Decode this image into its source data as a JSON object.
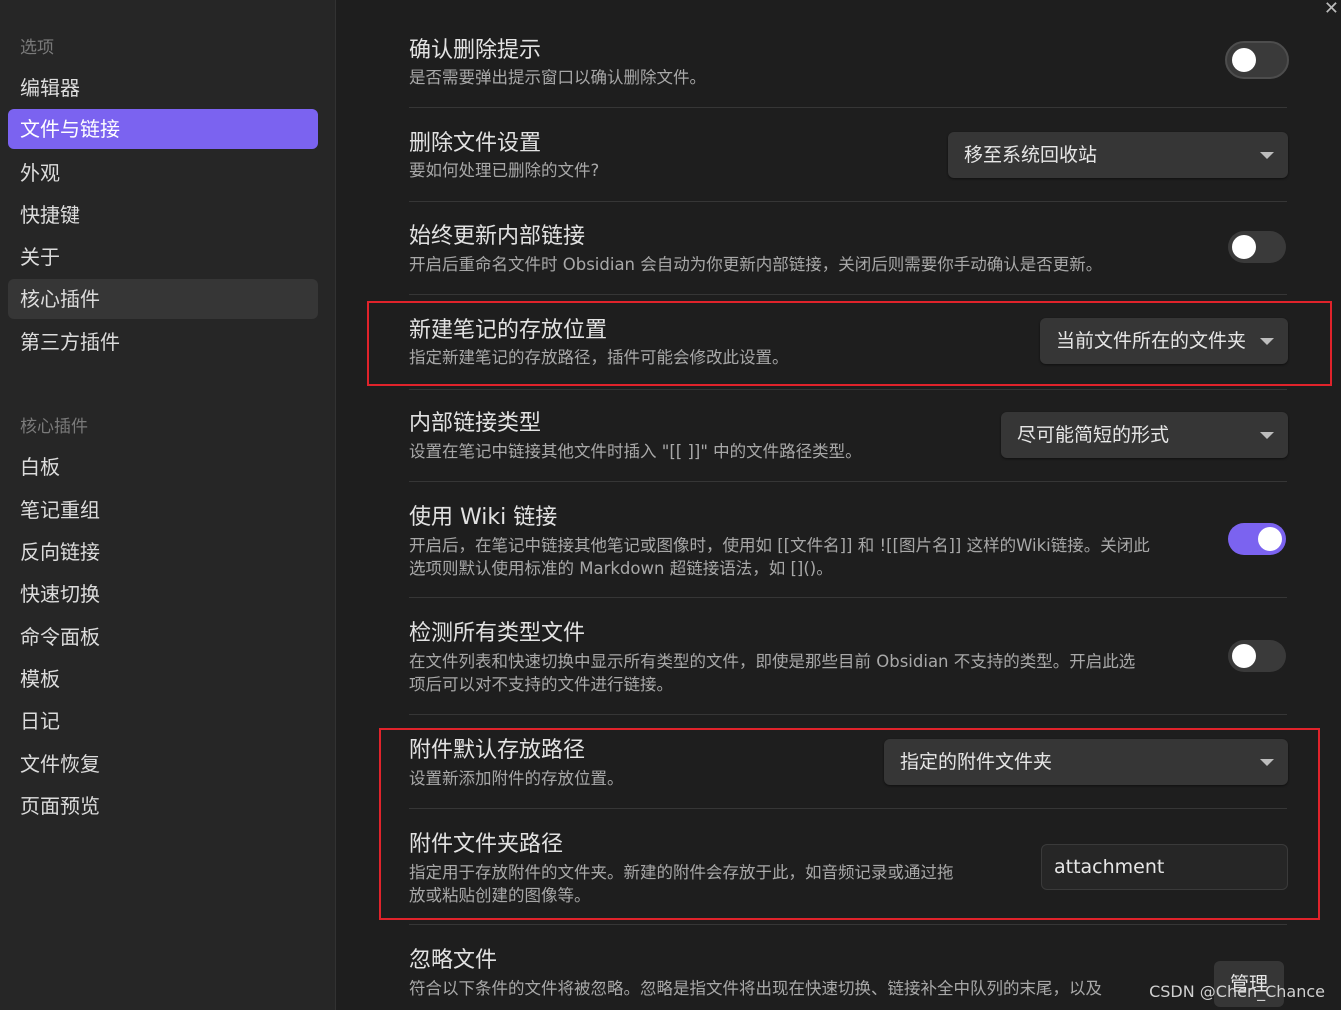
{
  "sidebar": {
    "section_options": "选项",
    "options": [
      {
        "label": "编辑器"
      },
      {
        "label": "文件与链接"
      },
      {
        "label": "外观"
      },
      {
        "label": "快捷键"
      },
      {
        "label": "关于"
      },
      {
        "label": "核心插件"
      },
      {
        "label": "第三方插件"
      }
    ],
    "section_plugins": "核心插件",
    "plugins": [
      {
        "label": "白板"
      },
      {
        "label": "笔记重组"
      },
      {
        "label": "反向链接"
      },
      {
        "label": "快速切换"
      },
      {
        "label": "命令面板"
      },
      {
        "label": "模板"
      },
      {
        "label": "日记"
      },
      {
        "label": "文件恢复"
      },
      {
        "label": "页面预览"
      }
    ]
  },
  "settings": {
    "confirm_delete": {
      "name": "确认删除提示",
      "desc": "是否需要弹出提示窗口以确认删除文件。",
      "enabled": false
    },
    "delete_files": {
      "name": "删除文件设置",
      "desc": "要如何处理已删除的文件?",
      "value": "移至系统回收站"
    },
    "update_links": {
      "name": "始终更新内部链接",
      "desc": "开启后重命名文件时 Obsidian 会自动为你更新内部链接，关闭后则需要你手动确认是否更新。",
      "enabled": false
    },
    "new_note_location": {
      "name": "新建笔记的存放位置",
      "desc": "指定新建笔记的存放路径，插件可能会修改此设置。",
      "value": "当前文件所在的文件夹"
    },
    "link_format": {
      "name": "内部链接类型",
      "desc": "设置在笔记中链接其他文件时插入 \"[[ ]]\" 中的文件路径类型。",
      "value": "尽可能简短的形式"
    },
    "wiki_links": {
      "name": "使用 Wiki 链接",
      "desc_line1": "开启后，在笔记中链接其他笔记或图像时，使用如 [[文件名]] 和 ![[图片名]] 这样的Wiki链接。关闭此",
      "desc_line2": "选项则默认使用标准的 Markdown 超链接语法，如 []()。",
      "enabled": true
    },
    "detect_all": {
      "name": "检测所有类型文件",
      "desc_line1": "在文件列表和快速切换中显示所有类型的文件，即使是那些目前 Obsidian 不支持的类型。开启此选",
      "desc_line2": "项后可以对不支持的文件进行链接。",
      "enabled": false
    },
    "attachment_location": {
      "name": "附件默认存放路径",
      "desc": "设置新添加附件的存放位置。",
      "value": "指定的附件文件夹"
    },
    "attachment_folder": {
      "name": "附件文件夹路径",
      "desc_line1": "指定用于存放附件的文件夹。新建的附件会存放于此，如音频记录或通过拖",
      "desc_line2": "放或粘贴创建的图像等。",
      "value": "attachment"
    },
    "ignore_files": {
      "name": "忽略文件",
      "desc": "符合以下条件的文件将被忽略。忽略是指文件将出现在快速切换、链接补全中队列的末尾，以及",
      "button": "管理"
    }
  },
  "watermark": "CSDN @Chen_Chance",
  "colors": {
    "accent": "#7b63f0",
    "highlight_box": "#e0232b",
    "background": "#1e1e1e",
    "sidebar": "#262626"
  }
}
